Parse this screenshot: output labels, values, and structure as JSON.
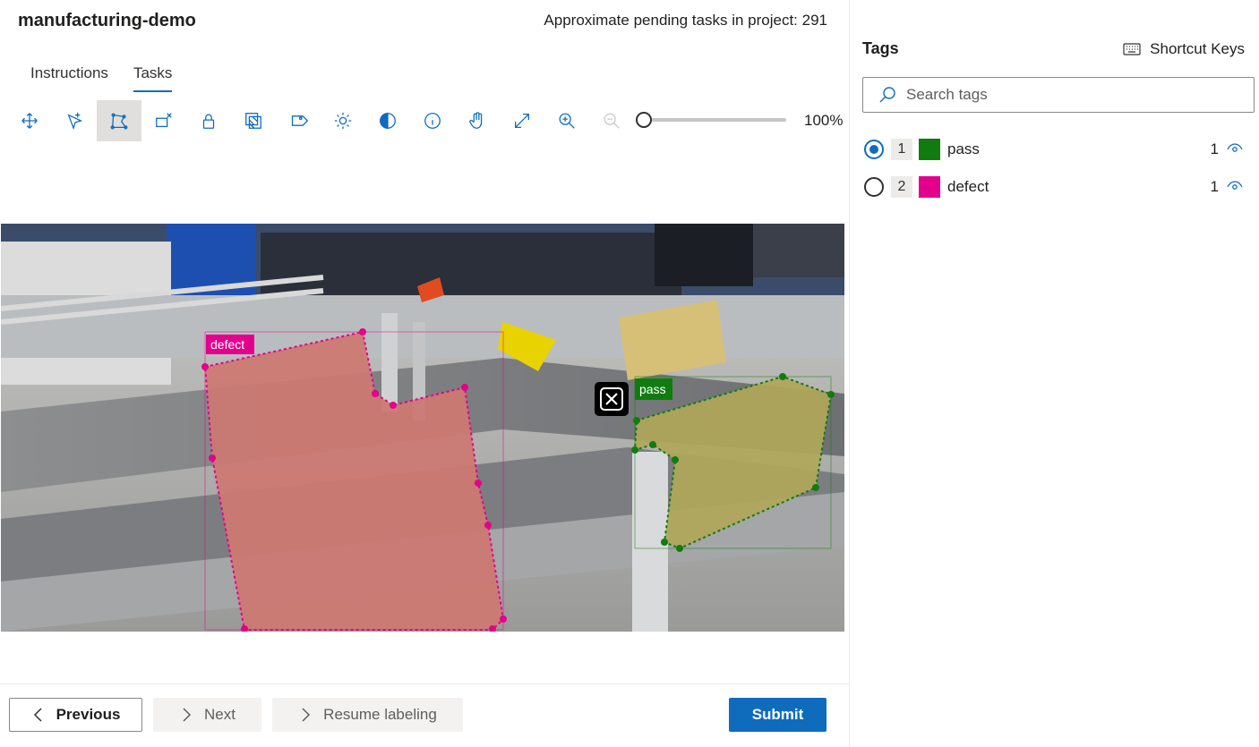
{
  "project": {
    "title": "manufacturing-demo",
    "pending_text": "Approximate pending tasks in project: 291"
  },
  "tabs": [
    {
      "label": "Instructions",
      "active": false
    },
    {
      "label": "Tasks",
      "active": true
    }
  ],
  "toolbar": {
    "tools": [
      {
        "name": "move-icon",
        "active": false
      },
      {
        "name": "select-icon",
        "active": false
      },
      {
        "name": "polygon-icon",
        "active": true
      },
      {
        "name": "delete-region-icon",
        "active": false
      },
      {
        "name": "lock-icon",
        "active": false
      },
      {
        "name": "region-copy-icon",
        "active": false
      },
      {
        "name": "tag-icon",
        "active": false
      },
      {
        "name": "brightness-icon",
        "active": false
      },
      {
        "name": "contrast-icon",
        "active": false
      },
      {
        "name": "info-icon",
        "active": false
      },
      {
        "name": "pan-hand-icon",
        "active": false
      },
      {
        "name": "fit-expand-icon",
        "active": false
      },
      {
        "name": "zoom-in-icon",
        "active": false
      },
      {
        "name": "zoom-out-icon",
        "active": false
      }
    ],
    "zoom_value": "100%",
    "zoom_level": 0
  },
  "canvas": {
    "regions": [
      {
        "label": "defect",
        "color": "#e3008c"
      },
      {
        "label": "pass",
        "color": "#107c10"
      }
    ]
  },
  "footer": {
    "previous": "Previous",
    "next": "Next",
    "resume": "Resume labeling",
    "submit": "Submit"
  },
  "sidebar": {
    "title": "Tags",
    "shortcut_keys": "Shortcut Keys",
    "search_placeholder": "Search tags",
    "tags": [
      {
        "number": "1",
        "name": "pass",
        "color": "#107c10",
        "count": "1",
        "selected": true
      },
      {
        "number": "2",
        "name": "defect",
        "color": "#e3008c",
        "count": "1",
        "selected": false
      }
    ]
  },
  "colors": {
    "accent": "#0f6cbd"
  }
}
